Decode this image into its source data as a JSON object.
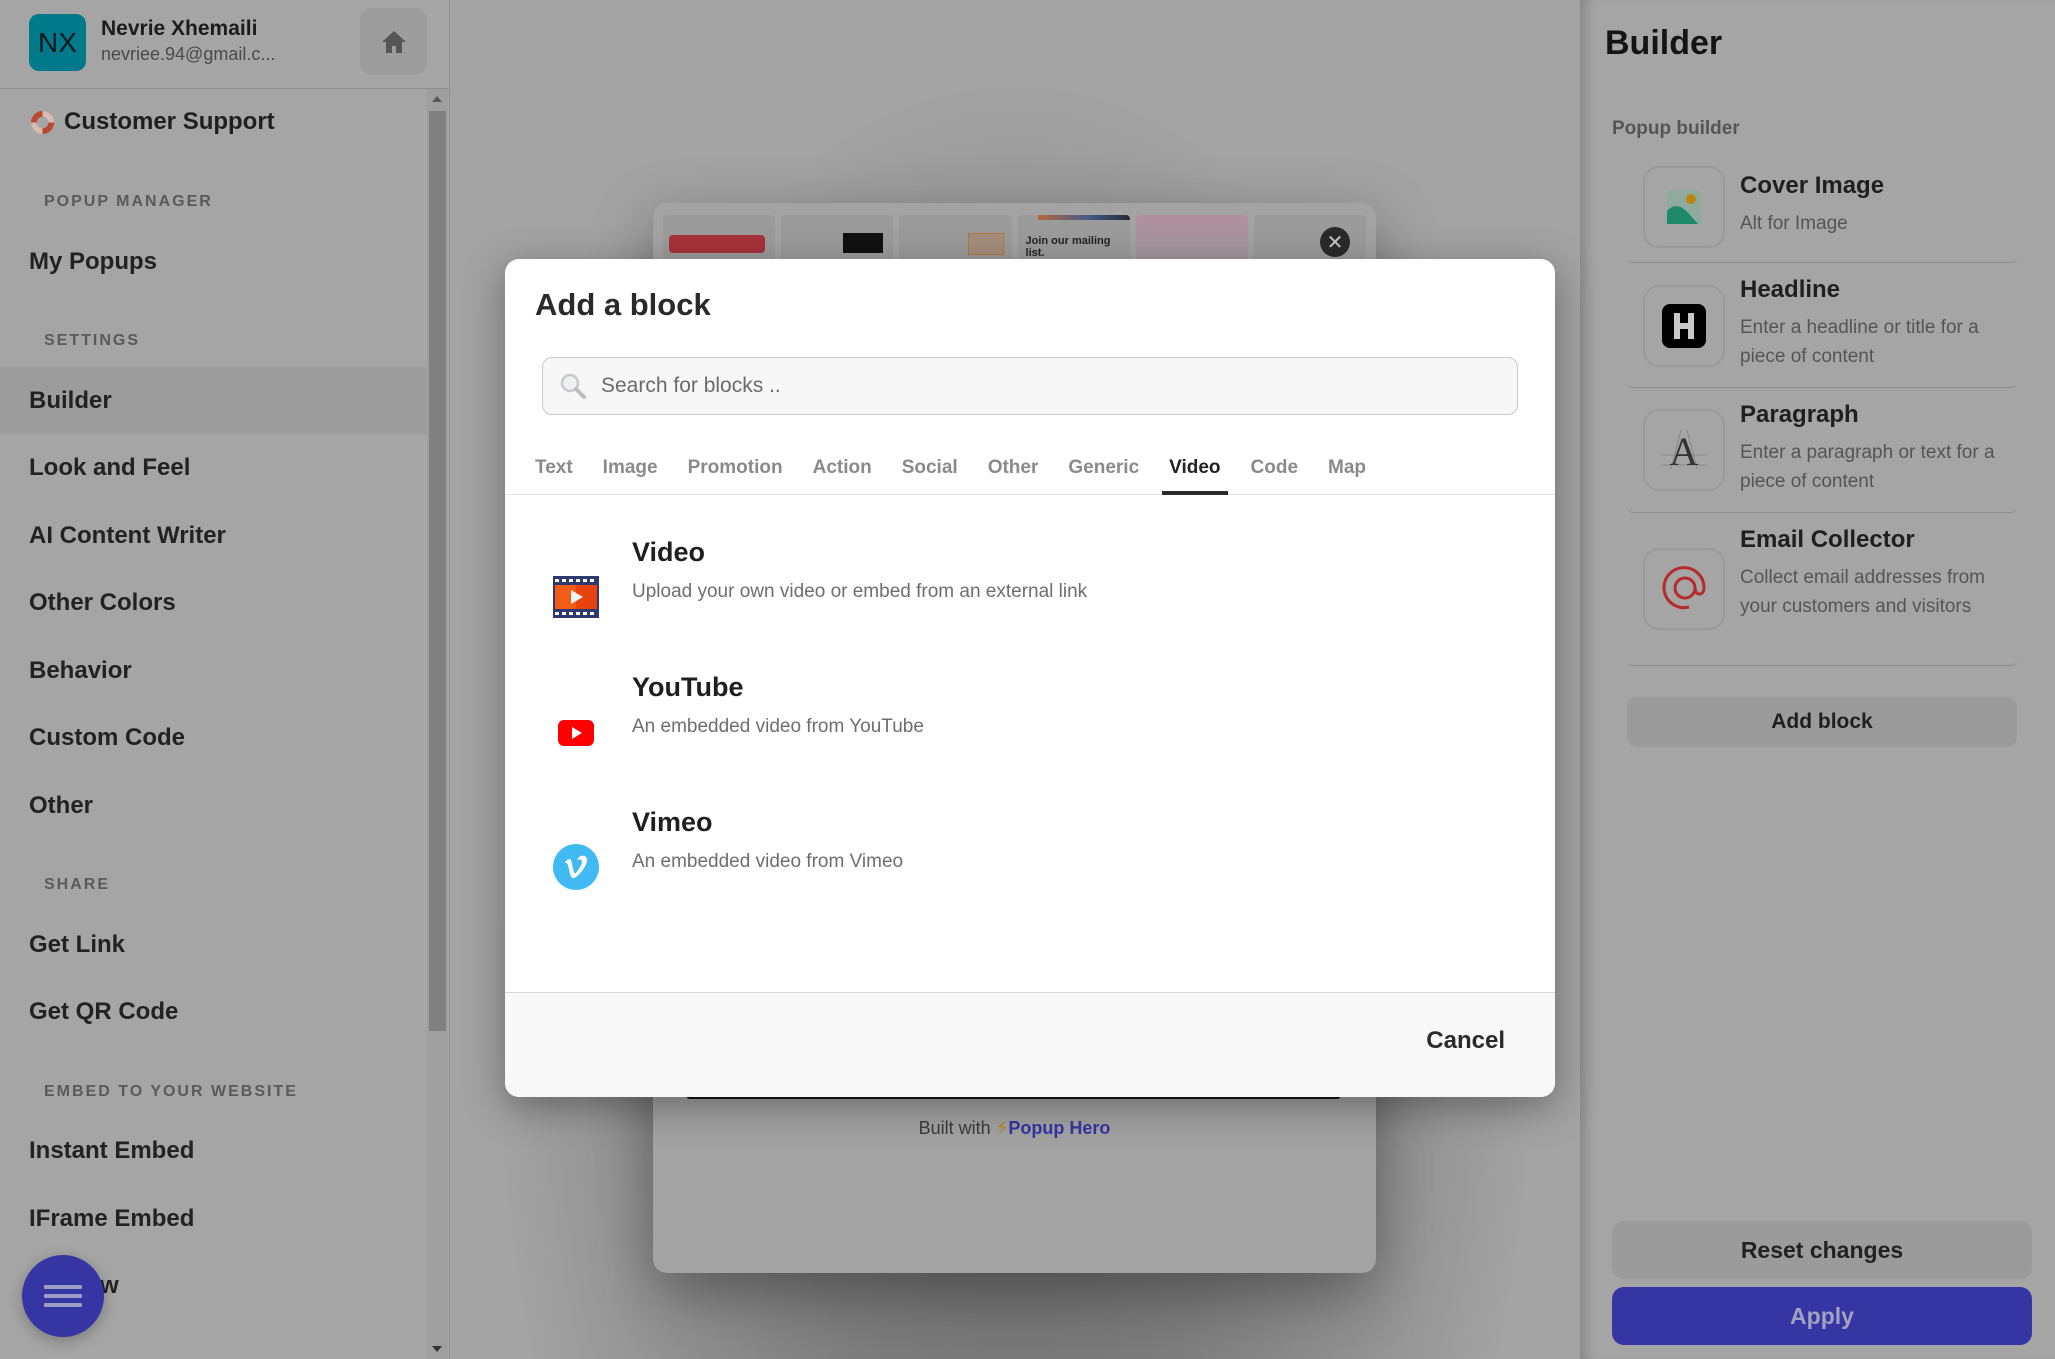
{
  "user": {
    "initials": "NX",
    "name": "Nevrie Xhemaili",
    "email": "nevriee.94@gmail.c..."
  },
  "sidebar": {
    "support_label": "Customer Support",
    "sections": [
      {
        "title": "POPUP MANAGER",
        "items": [
          {
            "label": "My Popups"
          }
        ]
      },
      {
        "title": "SETTINGS",
        "items": [
          {
            "label": "Builder",
            "active": true
          },
          {
            "label": "Look and Feel"
          },
          {
            "label": "AI Content Writer"
          },
          {
            "label": "Other Colors"
          },
          {
            "label": "Behavior"
          },
          {
            "label": "Custom Code"
          },
          {
            "label": "Other"
          }
        ]
      },
      {
        "title": "SHARE",
        "items": [
          {
            "label": "Get Link"
          },
          {
            "label": "Get QR Code"
          }
        ]
      },
      {
        "title": "EMBED TO YOUR WEBSITE",
        "items": [
          {
            "label": "Instant Embed"
          },
          {
            "label": "IFrame Embed"
          },
          {
            "label": "w"
          }
        ]
      }
    ]
  },
  "preview": {
    "strip_text": "Join our mailing list.",
    "built_with": "Built with",
    "bolt": "⚡",
    "brand": "Popup Hero"
  },
  "modal": {
    "title": "Add a block",
    "search_placeholder": "Search for blocks ..",
    "search_value": "",
    "tabs": [
      "Text",
      "Image",
      "Promotion",
      "Action",
      "Social",
      "Other",
      "Generic",
      "Video",
      "Code",
      "Map"
    ],
    "active_tab": "Video",
    "blocks": [
      {
        "name": "Video",
        "desc": "Upload your own video or embed from an external link",
        "icon": "video-film-icon"
      },
      {
        "name": "YouTube",
        "desc": "An embedded video from YouTube",
        "icon": "youtube-icon"
      },
      {
        "name": "Vimeo",
        "desc": "An embedded video from Vimeo",
        "icon": "vimeo-icon"
      }
    ],
    "cancel_label": "Cancel"
  },
  "right_panel": {
    "title": "Builder",
    "subtitle": "Popup builder",
    "items": [
      {
        "name": "Cover Image",
        "desc": "Alt for Image",
        "icon": "image-icon"
      },
      {
        "name": "Headline",
        "desc": "Enter a headline or title for a piece of content",
        "icon": "headline-icon"
      },
      {
        "name": "Paragraph",
        "desc": "Enter a paragraph or text for a piece of content",
        "icon": "paragraph-icon"
      },
      {
        "name": "Email Collector",
        "desc": "Collect email addresses from your customers and visitors",
        "icon": "at-sign-icon"
      }
    ],
    "add_block_label": "Add block",
    "reset_label": "Reset changes",
    "apply_label": "Apply"
  },
  "colors": {
    "accent": "#3535a3",
    "avatar": "#007a8a",
    "youtube": "#ff0000",
    "vimeo": "#1ab7ea"
  }
}
